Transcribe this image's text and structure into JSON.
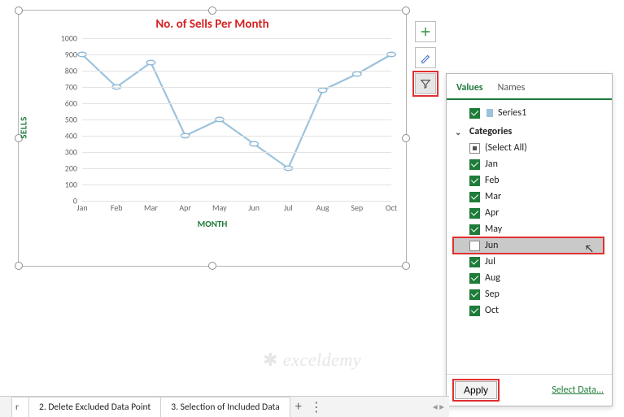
{
  "chart_data": {
    "type": "line",
    "title": "No. of Sells Per Month",
    "xlabel": "MONTH",
    "ylabel": "SELLS",
    "categories": [
      "Jan",
      "Feb",
      "Mar",
      "Apr",
      "May",
      "Jun",
      "Jul",
      "Aug",
      "Sep",
      "Oct"
    ],
    "values": [
      900,
      700,
      850,
      400,
      500,
      350,
      200,
      680,
      780,
      900
    ],
    "ylim": [
      0,
      1000
    ],
    "yticks": [
      0,
      100,
      200,
      300,
      400,
      500,
      600,
      700,
      800,
      900,
      1000
    ],
    "series": [
      {
        "name": "Series1",
        "color": "#9cc3dc"
      }
    ]
  },
  "chart_buttons": {
    "plus": "plus-icon",
    "brush": "brush-icon",
    "filter": "filter-icon"
  },
  "filter_panel": {
    "tabs": {
      "values": "Values",
      "names": "Names",
      "active": "values"
    },
    "series_section": {
      "items": [
        {
          "label": "Series1",
          "checked": true
        }
      ]
    },
    "categories_section": {
      "label": "Categories",
      "select_all_label": "(Select All)",
      "select_all_state": "tri",
      "items": [
        {
          "label": "Jan",
          "checked": true
        },
        {
          "label": "Feb",
          "checked": true
        },
        {
          "label": "Mar",
          "checked": true
        },
        {
          "label": "Apr",
          "checked": true
        },
        {
          "label": "May",
          "checked": true
        },
        {
          "label": "Jun",
          "checked": false,
          "highlight": true
        },
        {
          "label": "Jul",
          "checked": true
        },
        {
          "label": "Aug",
          "checked": true
        },
        {
          "label": "Sep",
          "checked": true
        },
        {
          "label": "Oct",
          "checked": true
        }
      ]
    },
    "footer": {
      "apply": "Apply",
      "select_data": "Select Data..."
    }
  },
  "sheet_tabs": {
    "items": [
      {
        "label": "r",
        "truncated_left": true
      },
      {
        "label": "2. Delete Excluded Data Point"
      },
      {
        "label": "3. Selection of Included Data"
      }
    ],
    "add_icon": "+",
    "menu_icon": "⋮"
  },
  "watermark": "exceldemy"
}
